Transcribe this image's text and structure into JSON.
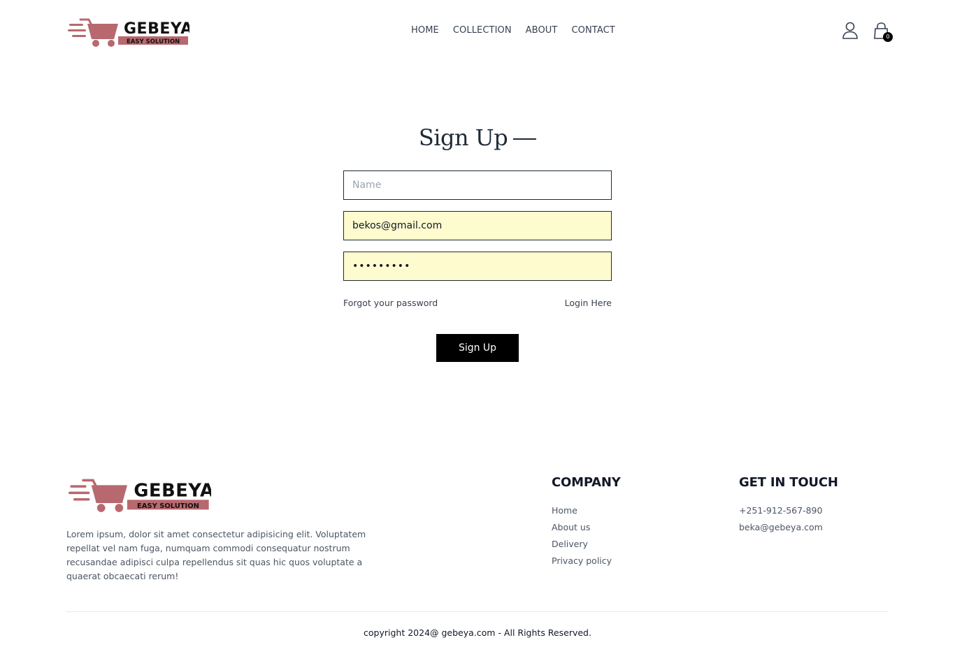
{
  "brand": {
    "name": "GEBEYA",
    "tagline": "EASY SOLUTION",
    "accent_color": "#b8686f"
  },
  "nav": {
    "items": [
      {
        "label": "HOME"
      },
      {
        "label": "COLLECTION"
      },
      {
        "label": "ABOUT"
      },
      {
        "label": "CONTACT"
      }
    ]
  },
  "header": {
    "profile_icon": "user-icon",
    "cart_icon": "shopping-bag-icon",
    "cart_count": "0"
  },
  "form": {
    "title": "Sign Up",
    "name_placeholder": "Name",
    "name_value": "",
    "email_value": "bekos@gmail.com",
    "password_value": "•••••••••",
    "forgot_label": "Forgot your password",
    "login_label": "Login Here",
    "submit_label": "Sign Up",
    "autofill_color": "#fefbcf"
  },
  "footer": {
    "description": "Lorem ipsum, dolor sit amet consectetur adipisicing elit. Voluptatem repellat vel nam fuga, numquam commodi consequatur nostrum recusandae adipisci culpa repellendus sit quas hic quos voluptate a quaerat obcaecati rerum!",
    "company": {
      "heading": "COMPANY",
      "links": [
        {
          "label": "Home"
        },
        {
          "label": "About us"
        },
        {
          "label": "Delivery"
        },
        {
          "label": "Privacy policy"
        }
      ]
    },
    "contact": {
      "heading": "GET IN TOUCH",
      "phone": "+251-912-567-890",
      "email": "beka@gebeya.com"
    },
    "copyright": "copyright 2024@ gebeya.com - All Rights Reserved."
  }
}
